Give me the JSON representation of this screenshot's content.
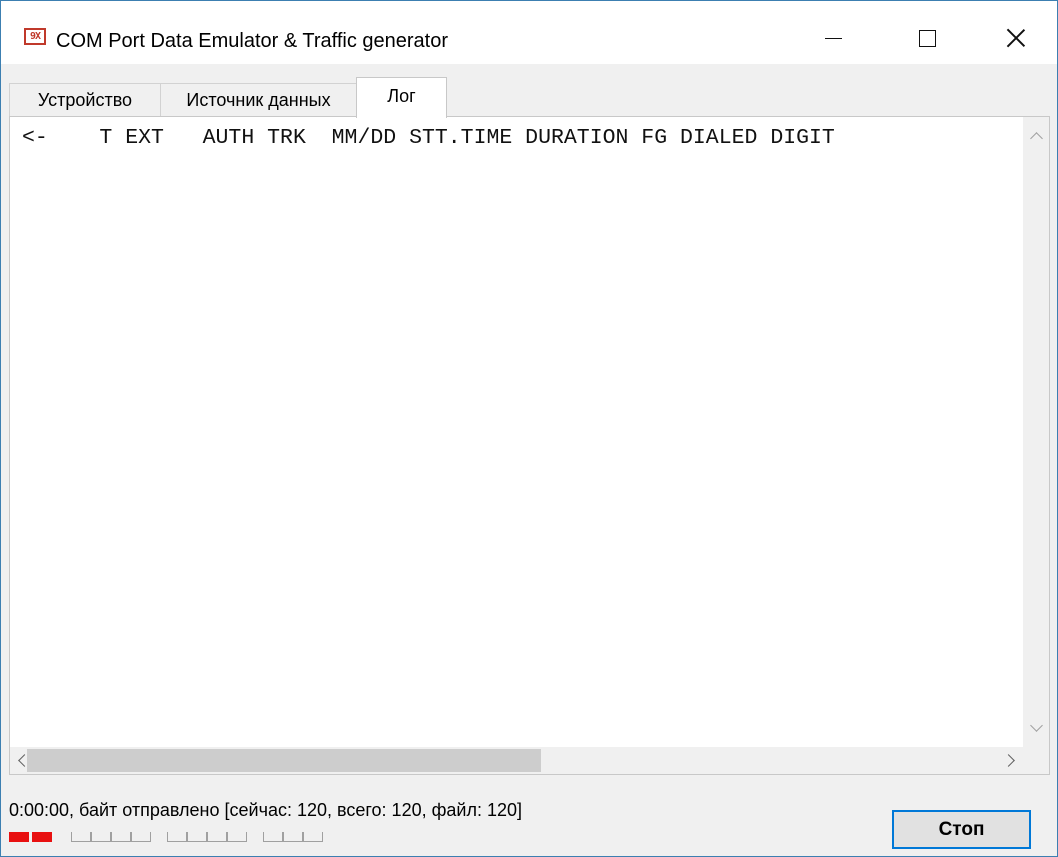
{
  "window": {
    "title": "COM Port Data Emulator & Traffic generator",
    "icon_text": "9X",
    "accent_color": "#c0392b"
  },
  "tabs": [
    {
      "label": "Устройство",
      "active": false
    },
    {
      "label": "Источник данных",
      "active": false
    },
    {
      "label": "Лог",
      "active": true
    }
  ],
  "log": {
    "content": "<-    T EXT   AUTH TRK  MM/DD STT.TIME DURATION FG DIALED DIGIT"
  },
  "status": {
    "text": "0:00:00, байт отправлено [сейчас: 120, всего: 120, файл: 120]",
    "indicator_color_on": "#e81010",
    "indicators": [
      [
        true,
        true
      ],
      [
        false,
        false,
        false,
        false
      ],
      [
        false,
        false,
        false,
        false
      ],
      [
        false,
        false,
        false
      ]
    ]
  },
  "buttons": {
    "stop_label": "Стоп"
  },
  "icons": {
    "minimize": "minimize-icon",
    "maximize": "maximize-icon",
    "close": "close-icon"
  }
}
